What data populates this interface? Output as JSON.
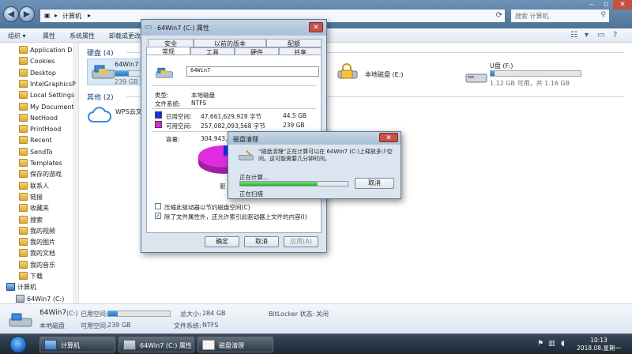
{
  "explorer": {
    "breadcrumb": "计算机",
    "search_placeholder": "搜索 计算机",
    "toolbar": {
      "organize": "组织 ▾",
      "properties": "属性",
      "system_properties": "系统属性",
      "uninstall": "卸载或更改程序"
    },
    "sidebar": [
      "Application D",
      "Cookies",
      "Desktop",
      "IntelGraphicsP",
      "Local Settings",
      "My Document",
      "NetHood",
      "PrintHood",
      "Recent",
      "SendTo",
      "Templates",
      "保存的游戏",
      "联系人",
      "链接",
      "收藏夹",
      "搜索",
      "我的视频",
      "我的图片",
      "我的文档",
      "我的音乐",
      "下载",
      "计算机",
      "64Win7 (C:)"
    ],
    "groups": {
      "hdd": "硬盘 (4)",
      "other": "其他 (2)"
    },
    "drives": {
      "c": {
        "name": "64Win7",
        "stats": "239 GB",
        "fill": 0.16
      },
      "e": {
        "name": "本地磁盘 (E:)"
      },
      "f": {
        "name": "U盘 (F:)",
        "stats": "1.12 GB 可用，共 1.16 GB",
        "fill": 0.04
      },
      "wps": {
        "name": "WPS云文档"
      }
    },
    "details": {
      "name": "64Win7",
      "drive_letter": "(C:)",
      "type": "本地磁盘",
      "used_label": "已用空间:",
      "free_label": "可用空间:",
      "free_value": "239 GB",
      "total_label": "总大小:",
      "total_value": "284 GB",
      "fs_label": "文件系统:",
      "fs_value": "NTFS",
      "bitlocker_label": "BitLocker 状态:",
      "bitlocker_value": "关闭",
      "used_fill": 0.16
    }
  },
  "props": {
    "title": "64Win7 (C:) 属性",
    "tabs": [
      "安全",
      "以前的版本",
      "配额",
      "常规",
      "工具",
      "硬件",
      "共享"
    ],
    "drive_name": "64Win7",
    "type_label": "类型:",
    "type_value": "本地磁盘",
    "fs_label": "文件系统:",
    "fs_value": "NTFS",
    "used_label": "已用空间:",
    "used_bytes": "47,661,629,928 字节",
    "used_gb": "44.5 GB",
    "free_label": "可用空间:",
    "free_bytes": "257,082,093,568 字节",
    "free_gb": "239 GB",
    "capacity_label": "容量:",
    "capacity_bytes": "304,943,",
    "drive_caption": "驱",
    "compress_label": "压缩此驱动器以节约磁盘空间(C)",
    "index_label": "除了文件属性外，还允许索引此驱动器上文件的内容(I)",
    "ok": "确定",
    "cancel": "取消",
    "apply": "应用(A)",
    "colors": {
      "used": "#1a2ce8",
      "free": "#e02ce0"
    }
  },
  "cleanup": {
    "title": "磁盘清理",
    "message": "“磁盘清理”正在计算可以在 64Win7 (C:)上释放多少空间。这可能需要几分钟时间。",
    "calculating": "正在计算...",
    "scanning": "正在扫描",
    "cancel": "取消",
    "progress": 0.72
  },
  "taskbar": {
    "tasks": [
      "计算机",
      "64Win7 (C:) 属性",
      "磁盘清理"
    ],
    "time": "10:13",
    "date": "2018.08.星期一"
  }
}
